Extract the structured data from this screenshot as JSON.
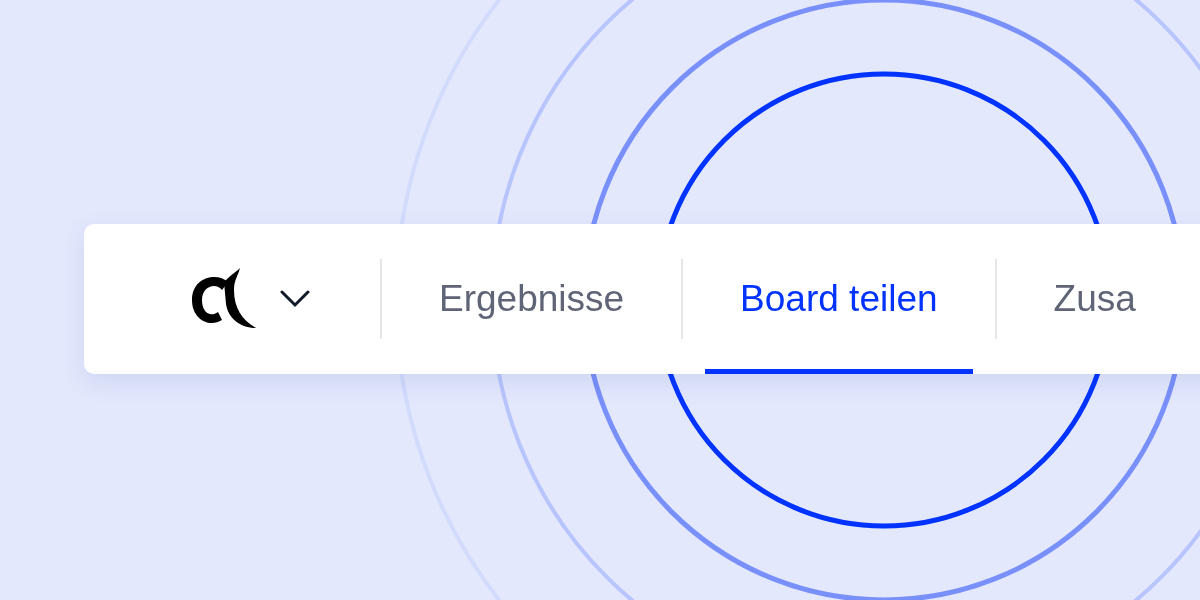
{
  "tabs": [
    {
      "label": "Ergebnisse",
      "selected": false
    },
    {
      "label": "Board teilen",
      "selected": true
    },
    {
      "label": "Zusa",
      "selected": false
    }
  ]
}
